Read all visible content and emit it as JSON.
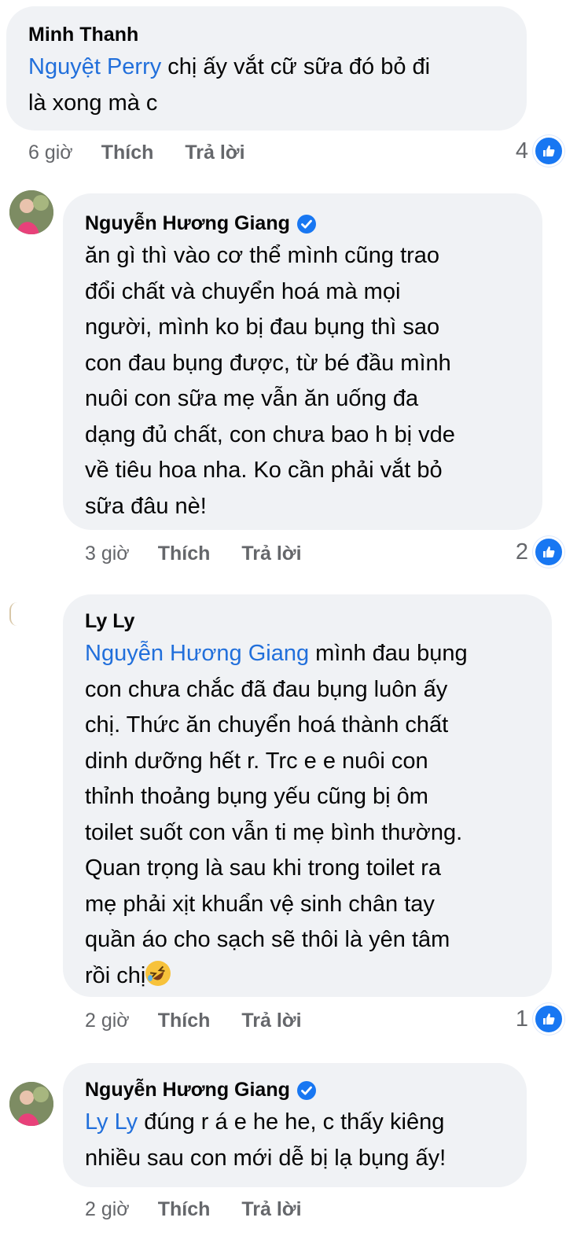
{
  "comments": [
    {
      "author": "Minh Thanh",
      "mention": "Nguyệt Perry",
      "lines": [
        " chị ấy vắt cữ sữa đó bỏ đi",
        "là xong mà c"
      ],
      "time": "6 giờ",
      "like_label": "Thích",
      "reply_label": "Trả lời",
      "reactions": "4"
    },
    {
      "author": "Nguyễn Hương Giang",
      "verified": true,
      "lines": [
        "ăn gì thì vào cơ thể mình cũng trao",
        "đổi chất và chuyển hoá mà mọi",
        "người, mình ko bị đau bụng thì sao",
        "con đau bụng được, từ bé đầu mình",
        "nuôi con sữa mẹ vẫn ăn uống đa",
        "dạng đủ chất, con chưa bao h bị vde",
        "về tiêu hoa nha. Ko cần phải vắt bỏ",
        "sữa đâu nè!"
      ],
      "time": "3 giờ",
      "like_label": "Thích",
      "reply_label": "Trả lời",
      "reactions": "2"
    },
    {
      "author": "Ly Ly",
      "mention": "Nguyễn Hương Giang",
      "lines": [
        " mình đau bụng",
        "con chưa chắc đã đau bụng luôn ấy",
        "chị. Thức ăn chuyển hoá thành chất",
        "dinh dưỡng hết r. Trc e e nuôi con",
        "thỉnh thoảng bụng yếu cũng bị ôm",
        "toilet suốt con vẫn ti mẹ bình thường.",
        "Quan trọng là sau khi trong toilet ra",
        "mẹ phải xịt khuẩn vệ sinh chân tay",
        "quần áo cho sạch sẽ thôi là yên tâm",
        "rồi chị"
      ],
      "emoji": "rolling-on-floor-laughing-emoji",
      "time": "2 giờ",
      "like_label": "Thích",
      "reply_label": "Trả lời",
      "reactions": "1"
    },
    {
      "author": "Nguyễn Hương Giang",
      "verified": true,
      "mention": "Ly Ly",
      "lines": [
        " đúng r á e he he, c thấy kiêng",
        "nhiều sau con mới dễ bị lạ bụng ấy!"
      ],
      "time": "2 giờ",
      "like_label": "Thích",
      "reply_label": "Trả lời"
    }
  ],
  "colors": {
    "bubble": "#f0f2f5",
    "mention": "#216fdb",
    "meta": "#65676b",
    "like": "#1877f2"
  },
  "icons": {
    "like": "thumbs-up-icon",
    "verified": "verified-badge-icon"
  }
}
